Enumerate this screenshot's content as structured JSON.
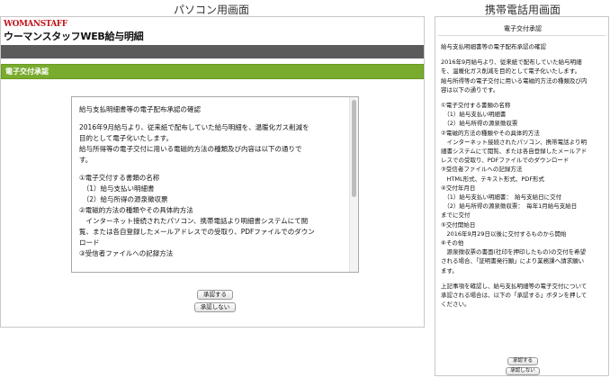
{
  "captions": {
    "pc": "パソコン用画面",
    "mobile": "携帯電話用画面"
  },
  "pc": {
    "logo_top": "WOMANSTAFF",
    "logo_main": "ウーマンスタッフWEB給与明細",
    "section_title": "電子交付承認",
    "lines": [
      "給与支払明細書等の電子配布承認の確認",
      "",
      "2016年9月給与より、従来紙で配布していた給与明細を、温暖化ガス削減を",
      "目的として電子化いたします。",
      "給与所得等の電子交付に用いる電磁的方法の種類及び内容は以下の通りで",
      "す。",
      "",
      "①電子交付する書類の名称",
      "　（1）給与支払い明細書",
      "　（2）給与所得の源泉徴収票",
      "②電磁的方法の種類やその具体的方法",
      "　インターネット接続されたパソコン、携帯電話より明細書システムにて閲",
      "覧、または各自登録したメールアドレスでの受取り、PDFファイルでのダウン",
      "ロード",
      "③受信者ファイルへの記録方法"
    ],
    "approve_label": "承認する",
    "decline_label": "承認しない"
  },
  "mobile": {
    "title": "電子交付承認",
    "lines": [
      "給与支払明細書等の電子配布承認の確認",
      "",
      "2016年9月給与より、従来紙で配布していた給与明細",
      "を、温暖化ガス削減を目的として電子化いたします。",
      "給与所得等の電子交付に用いる電磁的方法の種類及び内",
      "容は以下の通りです。",
      "",
      "①電子交付する書類の名称",
      "　（1）給与支払い明細書",
      "　（2）給与所得の源泉徴収票",
      "②電磁的方法の種類やその具体的方法",
      "　インターネット接続されたパソコン、携帯電話より明",
      "細書システムにて閲覧、または各自登録したメールアド",
      "レスでの受取り、PDFファイルでのダウンロード",
      "③受信者ファイルへの記録方法",
      "　HTML形式、テキスト形式、PDF形式",
      "④交付年月日",
      "　（1）給与支払い明細書：　給与支給日に交付",
      "　（2）給与所得の源泉徴収票：　毎年1月給与支給日",
      "までに交付",
      "⑤交付開始日",
      "　2016年9月29日以後に交付するものから開始",
      "⑥その他",
      "　源泉徴収票の書面(社印を押印したもの)の交付を希望",
      "される場合、「証明書発行願」により業務課へ請求願い",
      "ます。",
      "",
      "上記事項を確認し、給与支払明細等の電子交付について",
      "承認される場合は、以下の「承認する」ボタンを押して",
      "ください。"
    ],
    "approve_label": "承認する",
    "decline_label": "承認しない"
  }
}
